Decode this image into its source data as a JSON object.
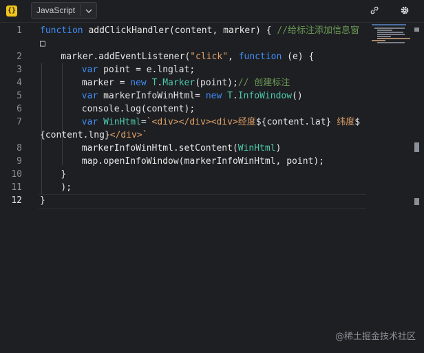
{
  "toolbar": {
    "logo_text": "{}",
    "language": "JavaScript",
    "icons": [
      "code-logo-icon",
      "chevron-down-icon",
      "link-icon",
      "gear-icon"
    ]
  },
  "editor": {
    "line_numbers": [
      "1",
      "2",
      "3",
      "4",
      "5",
      "6",
      "7",
      "8",
      "9",
      "10",
      "11",
      "12"
    ],
    "current_line": "12",
    "lines": [
      {
        "indent": 0,
        "tokens": [
          [
            "kw",
            "function"
          ],
          [
            "fn",
            " addClickHandler(content, marker) { "
          ],
          [
            "cmt",
            "//给标注添加信息窗"
          ]
        ]
      },
      {
        "indent": 0,
        "tokens": [
          [
            "txt",
            "□"
          ]
        ]
      },
      {
        "indent": 4,
        "tokens": [
          [
            "fn",
            "marker.addEventListener("
          ],
          [
            "str",
            "\"click\""
          ],
          [
            "fn",
            ", "
          ],
          [
            "kw",
            "function"
          ],
          [
            "fn",
            " (e) {"
          ]
        ]
      },
      {
        "indent": 8,
        "tokens": [
          [
            "kw",
            "var"
          ],
          [
            "fn",
            " point = e.lnglat;"
          ]
        ]
      },
      {
        "indent": 8,
        "tokens": [
          [
            "fn",
            "marker = "
          ],
          [
            "kw",
            "new"
          ],
          [
            "fn",
            " "
          ],
          [
            "cls",
            "T"
          ],
          [
            "fn",
            "."
          ],
          [
            "cls",
            "Marker"
          ],
          [
            "fn",
            "(point);"
          ],
          [
            "cmt",
            "// 创建标注"
          ]
        ]
      },
      {
        "indent": 8,
        "tokens": [
          [
            "kw",
            "var"
          ],
          [
            "fn",
            " markerInfoWinHtml= "
          ],
          [
            "kw",
            "new"
          ],
          [
            "fn",
            " "
          ],
          [
            "cls",
            "T"
          ],
          [
            "fn",
            "."
          ],
          [
            "cls",
            "InfoWindow"
          ],
          [
            "fn",
            "()"
          ]
        ]
      },
      {
        "indent": 8,
        "tokens": [
          [
            "fn",
            "console.log(content);"
          ]
        ]
      },
      {
        "indent": 8,
        "tokens": [
          [
            "kw",
            "var"
          ],
          [
            "fn",
            " "
          ],
          [
            "cls",
            "WinHtml"
          ],
          [
            "fn",
            "="
          ],
          [
            "str",
            "`<div></div><div>经度"
          ],
          [
            "fn",
            "${content.lat}"
          ],
          [
            "str",
            " 纬度"
          ],
          [
            "fn",
            "$"
          ]
        ]
      },
      {
        "indent": 0,
        "tokens": [
          [
            "fn",
            "{content.lng}"
          ],
          [
            "str",
            "</div>`"
          ]
        ]
      },
      {
        "indent": 8,
        "tokens": [
          [
            "fn",
            "markerInfoWinHtml.setContent("
          ],
          [
            "cls",
            "WinHtml"
          ],
          [
            "fn",
            ")"
          ]
        ]
      },
      {
        "indent": 8,
        "tokens": [
          [
            "fn",
            "map.openInfoWindow(markerInfoWinHtml, point);"
          ]
        ]
      },
      {
        "indent": 4,
        "tokens": [
          [
            "fn",
            "}"
          ]
        ]
      },
      {
        "indent": 4,
        "tokens": [
          [
            "fn",
            ");"
          ]
        ]
      },
      {
        "indent": 0,
        "tokens": [
          [
            "fn",
            "}"
          ]
        ]
      }
    ]
  },
  "watermark": "@稀土掘金技术社区"
}
